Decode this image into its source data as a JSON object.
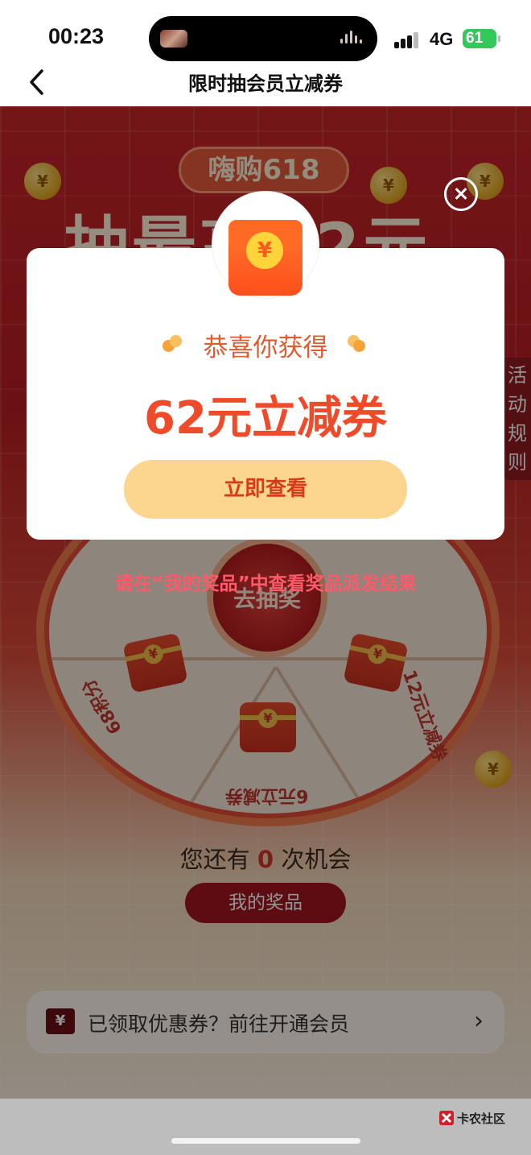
{
  "status_bar": {
    "time": "00:23",
    "network": "4G",
    "battery": "61"
  },
  "nav": {
    "title": "限时抽会员立减券"
  },
  "background": {
    "hero_badge": "嗨购618",
    "hero_title_partial": "抽最高62元",
    "rules_tab": "活动规则",
    "wheel_center": "去抽奖",
    "segments": [
      "68积分",
      "6元立减券",
      "12元立减券"
    ],
    "chances_prefix": "您还有",
    "chances_count": "0",
    "chances_suffix": "次机会",
    "my_prizes_button": "我的奖品",
    "coupon_bar_text": "已领取优惠券？前往开通会员",
    "coupon_icon": "¥",
    "coin_symbol": "¥"
  },
  "modal": {
    "congrats": "恭喜你获得",
    "prize": "62元立减券",
    "view_button": "立即查看",
    "packet_symbol": "¥"
  },
  "notice": "请在“我的奖品”中查看奖品派发结果",
  "watermark": "卡农社区",
  "colors": {
    "accent_red": "#ef4b2a",
    "button_yellow": "#fcd58f",
    "dark_red": "#a1181f"
  }
}
